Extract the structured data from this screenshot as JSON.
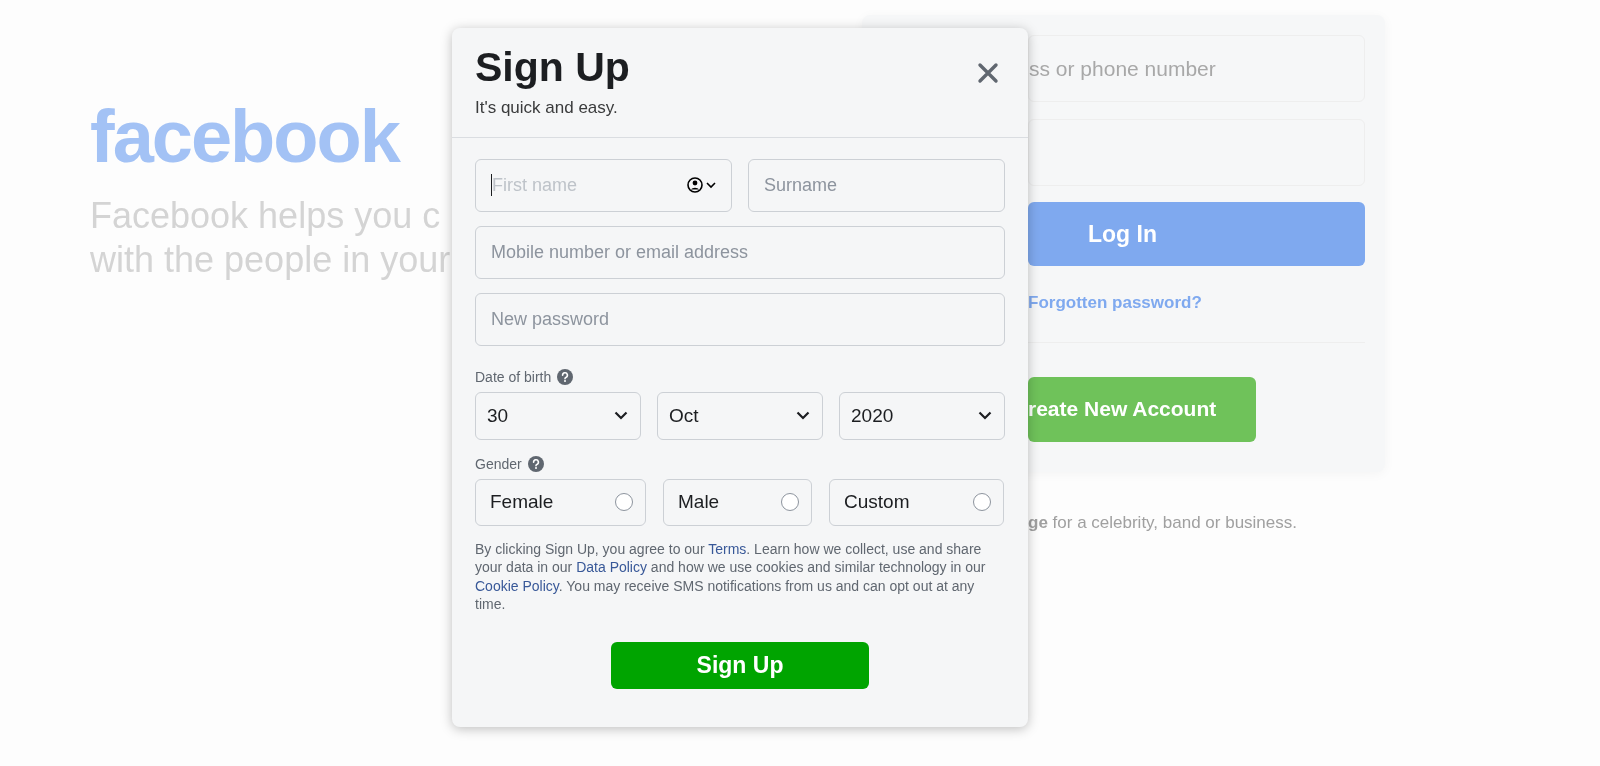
{
  "background": {
    "logo": "facebook",
    "tagline": [
      "Facebook helps you c",
      "with the people in your"
    ],
    "login": {
      "email_placeholder": "ss or phone number",
      "login_button": "Log In",
      "forgot_link": "Forgotten password?",
      "create_button": "reate New Account",
      "page_note": "**ge** for a celebrity, band or business."
    }
  },
  "dialog": {
    "title": "Sign Up",
    "subtitle": "It's quick and easy.",
    "field_rows": [
      [
        {
          "placeholder": "First name",
          "focused": true
        },
        {
          "placeholder": "Surname",
          "focused": false
        }
      ],
      [
        {
          "placeholder": "Mobile number or email address",
          "focused": false
        }
      ],
      [
        {
          "placeholder": "New password",
          "focused": false
        }
      ]
    ],
    "date_of_birth": {
      "label": "Date of birth",
      "selects": [
        "30",
        "Oct",
        "2020"
      ]
    },
    "gender": {
      "label": "Gender",
      "options": [
        {
          "label": "Female",
          "selected": false
        },
        {
          "label": "Male",
          "selected": false
        },
        {
          "label": "Custom",
          "selected": false
        }
      ]
    },
    "legal": [
      {
        "kind": "text",
        "text": "By clicking Sign Up, you agree to our "
      },
      {
        "kind": "link",
        "text": "Terms"
      },
      {
        "kind": "text",
        "text": ". Learn how we collect, use and share your data in our "
      },
      {
        "kind": "link",
        "text": "Data Policy"
      },
      {
        "kind": "text",
        "text": " and how we use cookies and similar technology in our "
      },
      {
        "kind": "link",
        "text": "Cookie Policy"
      },
      {
        "kind": "text",
        "text": ". You may receive SMS notifications from us and can opt out at any time."
      }
    ],
    "submit": "Sign Up"
  }
}
